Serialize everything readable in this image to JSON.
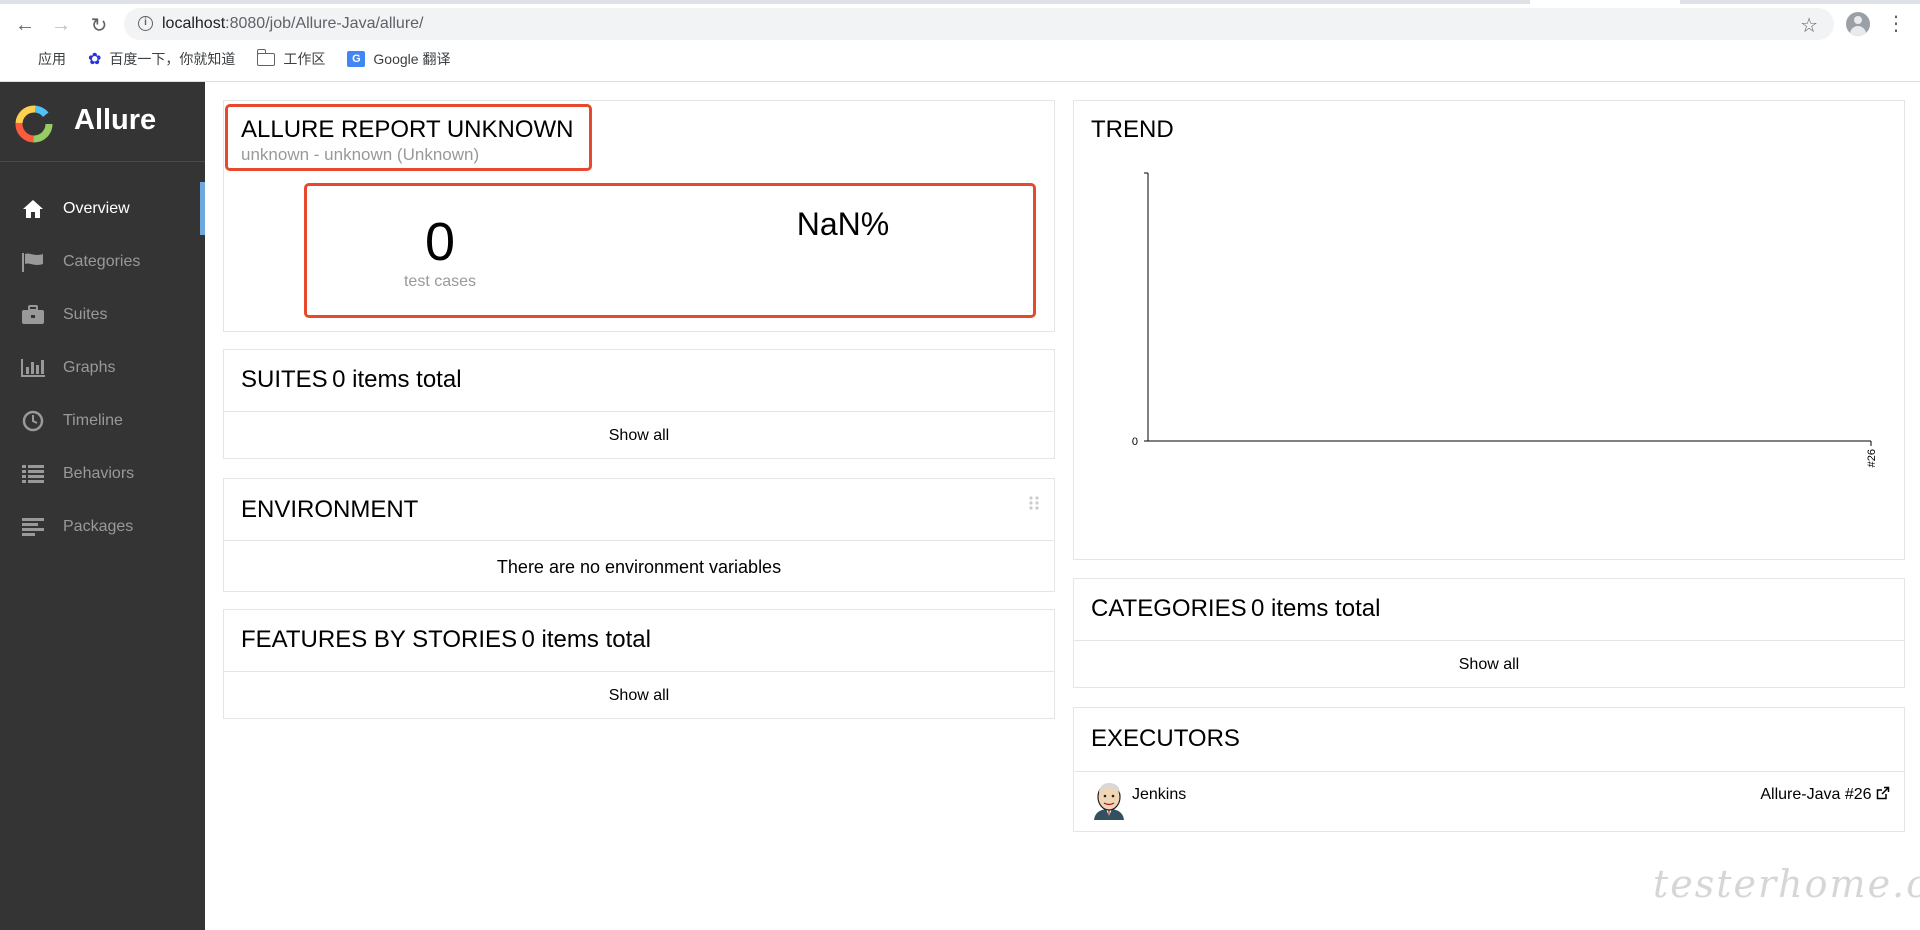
{
  "browser": {
    "url_host": "localhost",
    "url_path": ":8080/job/Allure-Java/allure/",
    "bookmarks": [
      {
        "label": "应用",
        "icon": "apps-grid-icon"
      },
      {
        "label": "百度一下，你就知道",
        "icon": "baidu-paw-icon"
      },
      {
        "label": "工作区",
        "icon": "folder-icon"
      },
      {
        "label": "Google 翻译",
        "icon": "google-translate-icon"
      }
    ]
  },
  "sidebar": {
    "brand": "Allure",
    "items": [
      {
        "label": "Overview",
        "icon": "home-icon",
        "active": true
      },
      {
        "label": "Categories",
        "icon": "flag-icon",
        "active": false
      },
      {
        "label": "Suites",
        "icon": "briefcase-icon",
        "active": false
      },
      {
        "label": "Graphs",
        "icon": "bar-chart-icon",
        "active": false
      },
      {
        "label": "Timeline",
        "icon": "clock-icon",
        "active": false
      },
      {
        "label": "Behaviors",
        "icon": "list-icon",
        "active": false
      },
      {
        "label": "Packages",
        "icon": "align-left-icon",
        "active": false
      }
    ]
  },
  "summary": {
    "title": "ALLURE REPORT UNKNOWN",
    "subtitle": "unknown - unknown (Unknown)",
    "test_cases_count": "0",
    "test_cases_label": "test cases",
    "percent": "NaN%"
  },
  "suites": {
    "title": "SUITES",
    "count": "0 items total",
    "show_all": "Show all"
  },
  "environment": {
    "title": "ENVIRONMENT",
    "empty": "There are no environment variables"
  },
  "features": {
    "title": "FEATURES BY STORIES",
    "count": "0 items total",
    "show_all": "Show all"
  },
  "trend": {
    "title": "TREND",
    "chart_data": {
      "type": "line",
      "x": [
        "#26"
      ],
      "series": [
        {
          "values": [
            0
          ]
        }
      ],
      "ytick_labels": [
        "0"
      ],
      "xtick_labels": [
        "#26"
      ]
    }
  },
  "categories": {
    "title": "CATEGORIES",
    "count": "0 items total",
    "show_all": "Show all"
  },
  "executors": {
    "title": "EXECUTORS",
    "name": "Jenkins",
    "build": "Allure-Java #26"
  },
  "watermark": "testerhome.com",
  "colors": {
    "accent": "#e6492d",
    "sidebar_bg": "#343434",
    "active_bar": "#6fa8dc"
  }
}
